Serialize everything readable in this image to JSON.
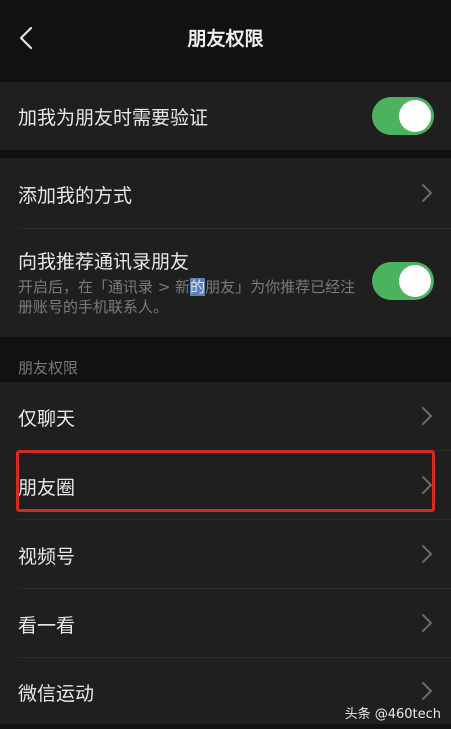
{
  "navbar": {
    "title": "朋友权限"
  },
  "settings_top": [
    {
      "label": "加我为朋友时需要验证",
      "toggle_on": true
    }
  ],
  "settings_middle": {
    "add_methods_label": "添加我的方式",
    "recommend_label": "向我推荐通讯录朋友",
    "recommend_desc_1": "开启后，在「通讯录 > 新",
    "recommend_desc_highlight": "的",
    "recommend_desc_2": "朋友」为你推荐已经注册账号的手机联系人。",
    "recommend_toggle_on": true
  },
  "permissions": {
    "header": "朋友权限",
    "items": [
      {
        "label": "仅聊天"
      },
      {
        "label": "朋友圈"
      },
      {
        "label": "视频号"
      },
      {
        "label": "看一看"
      },
      {
        "label": "微信运动"
      }
    ]
  },
  "watermark": {
    "text": "头条 @460tech"
  },
  "colors": {
    "background": "#111111",
    "cell": "#1f1f1f",
    "toggle_on": "#4cb25f",
    "highlight_border": "#d42a22"
  }
}
